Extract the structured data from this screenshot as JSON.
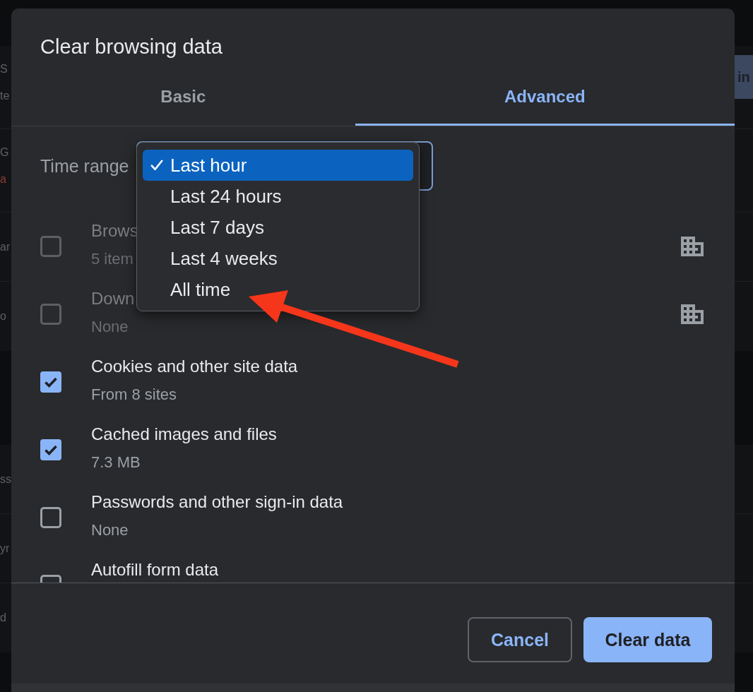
{
  "background_page": {
    "sections": [
      {
        "rows": [
          {
            "lines": [
              {
                "text": "S",
                "kind": "text"
              },
              {
                "text": "te",
                "kind": "text"
              }
            ],
            "button": "in"
          },
          {
            "lines": [
              {
                "text": "G",
                "kind": "text"
              },
              {
                "text": "a",
                "kind": "error"
              }
            ]
          },
          {
            "lines": [
              {
                "text": "ar",
                "kind": "text"
              }
            ]
          },
          {
            "lines": [
              {
                "text": "o",
                "kind": "text"
              }
            ]
          }
        ]
      },
      {
        "rows": [
          {
            "lines": [
              {
                "text": "ss",
                "kind": "text"
              }
            ]
          },
          {
            "lines": [
              {
                "text": "yr",
                "kind": "text"
              }
            ]
          },
          {
            "lines": [
              {
                "text": "d",
                "kind": "text"
              }
            ]
          }
        ]
      }
    ]
  },
  "dialog": {
    "title": "Clear browsing data",
    "tabs": [
      {
        "label": "Basic",
        "selected": false
      },
      {
        "label": "Advanced",
        "selected": true
      }
    ],
    "time_range": {
      "label": "Time range",
      "expanded": true,
      "options": [
        {
          "label": "Last hour",
          "selected": true
        },
        {
          "label": "Last 24 hours",
          "selected": false
        },
        {
          "label": "Last 7 days",
          "selected": false
        },
        {
          "label": "Last 4 weeks",
          "selected": false
        },
        {
          "label": "All time",
          "selected": false
        }
      ]
    },
    "items": [
      {
        "title": "Brows",
        "subtitle": "5 item",
        "checked": false,
        "disabled": true,
        "managed": true
      },
      {
        "title": "Down",
        "subtitle": "None",
        "checked": false,
        "disabled": true,
        "managed": true
      },
      {
        "title": "Cookies and other site data",
        "subtitle": "From 8 sites",
        "checked": true,
        "disabled": false,
        "managed": false
      },
      {
        "title": "Cached images and files",
        "subtitle": "7.3 MB",
        "checked": true,
        "disabled": false,
        "managed": false
      },
      {
        "title": "Passwords and other sign-in data",
        "subtitle": "None",
        "checked": false,
        "disabled": false,
        "managed": false
      },
      {
        "title": "Autofill form data",
        "checked": false,
        "disabled": false,
        "managed": false
      }
    ],
    "buttons": [
      {
        "label": "Cancel",
        "kind": "secondary"
      },
      {
        "label": "Clear data",
        "kind": "primary"
      }
    ]
  },
  "annotations": [
    {
      "kind": "arrow"
    }
  ]
}
